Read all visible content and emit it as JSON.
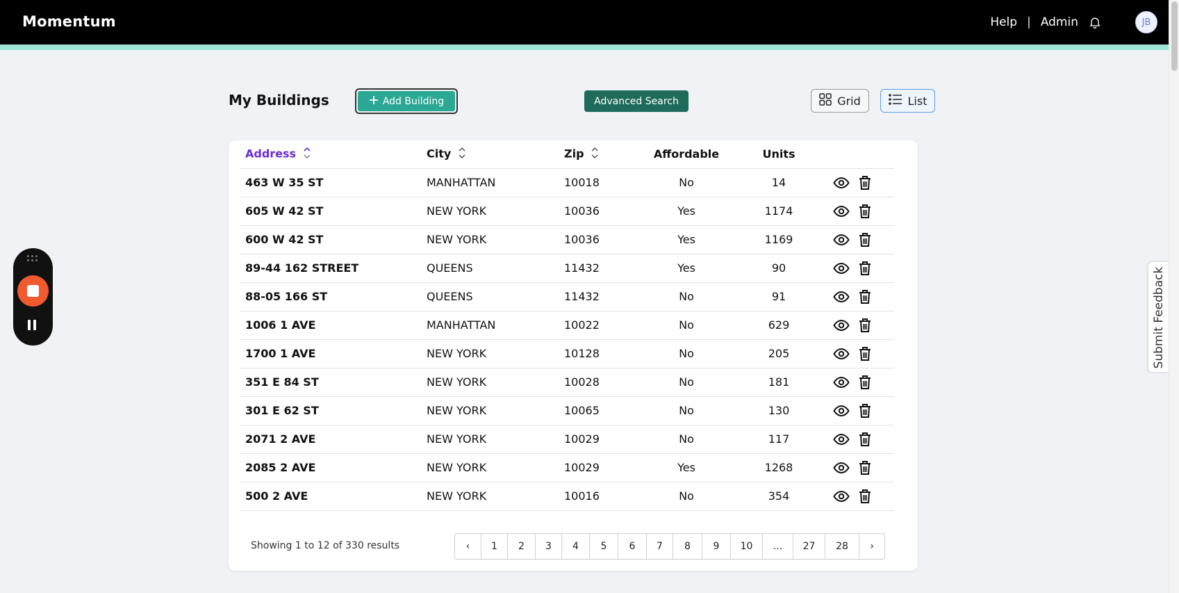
{
  "header": {
    "brand": "Momentum",
    "help": "Help",
    "separator": "|",
    "admin": "Admin",
    "avatar_initials": "JB"
  },
  "page": {
    "title": "My Buildings",
    "add_button": "Add Building",
    "advanced_search": "Advanced Search",
    "view_grid": "Grid",
    "view_list": "List"
  },
  "table": {
    "columns": {
      "address": "Address",
      "city": "City",
      "zip": "Zip",
      "affordable": "Affordable",
      "units": "Units"
    },
    "rows": [
      {
        "address": "463 W 35 ST",
        "city": "MANHATTAN",
        "zip": "10018",
        "affordable": "No",
        "units": "14"
      },
      {
        "address": "605 W 42 ST",
        "city": "NEW YORK",
        "zip": "10036",
        "affordable": "Yes",
        "units": "1174"
      },
      {
        "address": "600 W 42 ST",
        "city": "NEW YORK",
        "zip": "10036",
        "affordable": "Yes",
        "units": "1169"
      },
      {
        "address": "89-44 162 STREET",
        "city": "QUEENS",
        "zip": "11432",
        "affordable": "Yes",
        "units": "90"
      },
      {
        "address": "88-05 166 ST",
        "city": "QUEENS",
        "zip": "11432",
        "affordable": "No",
        "units": "91"
      },
      {
        "address": "1006 1 AVE",
        "city": "MANHATTAN",
        "zip": "10022",
        "affordable": "No",
        "units": "629"
      },
      {
        "address": "1700 1 AVE",
        "city": "NEW YORK",
        "zip": "10128",
        "affordable": "No",
        "units": "205"
      },
      {
        "address": "351 E 84 ST",
        "city": "NEW YORK",
        "zip": "10028",
        "affordable": "No",
        "units": "181"
      },
      {
        "address": "301 E 62 ST",
        "city": "NEW YORK",
        "zip": "10065",
        "affordable": "No",
        "units": "130"
      },
      {
        "address": "2071 2 AVE",
        "city": "NEW YORK",
        "zip": "10029",
        "affordable": "No",
        "units": "117"
      },
      {
        "address": "2085 2 AVE",
        "city": "NEW YORK",
        "zip": "10029",
        "affordable": "Yes",
        "units": "1268"
      },
      {
        "address": "500 2 AVE",
        "city": "NEW YORK",
        "zip": "10016",
        "affordable": "No",
        "units": "354"
      }
    ]
  },
  "results": {
    "prefix": "Showing",
    "from": "1",
    "to_word": "to",
    "to": "12",
    "of_word": "of",
    "total": "330",
    "suffix": "results"
  },
  "pagination": {
    "prev": "‹",
    "pages": [
      "1",
      "2",
      "3",
      "4",
      "5",
      "6",
      "7",
      "8",
      "9",
      "10",
      "...",
      "27",
      "28"
    ],
    "next": "›"
  },
  "feedback": {
    "label": "Submit Feedback"
  },
  "colors": {
    "accent": "#2aa894",
    "dark_green": "#1f6b5a",
    "sort_active": "#6b2bd6",
    "record": "#f05a2f",
    "topbar": "#000000"
  }
}
